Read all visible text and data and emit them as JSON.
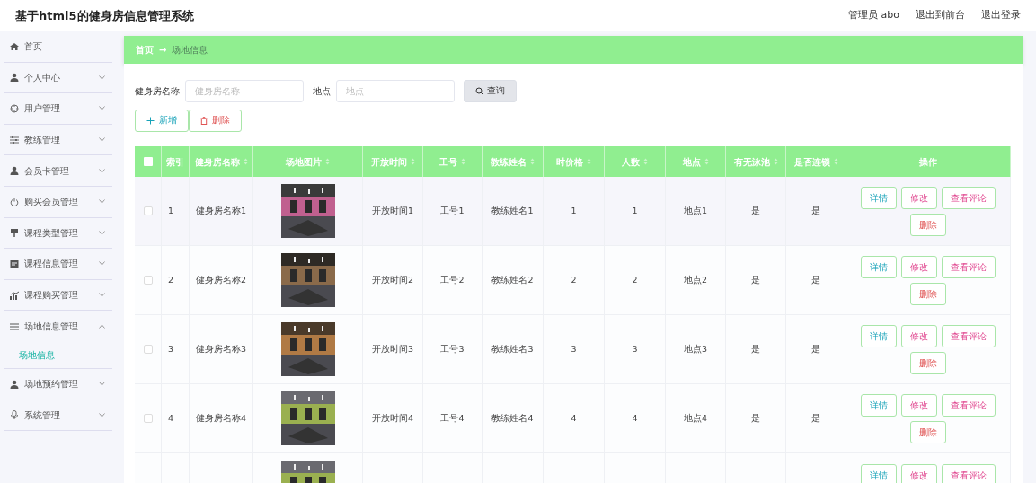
{
  "header": {
    "title": "基于html5的健身房信息管理系统",
    "links": [
      "管理员 abo",
      "退出到前台",
      "退出登录"
    ]
  },
  "sidebar": {
    "items": [
      {
        "label": "首页"
      },
      {
        "label": "个人中心",
        "expanded": false
      },
      {
        "label": "用户管理",
        "expanded": false
      },
      {
        "label": "教练管理",
        "expanded": false
      },
      {
        "label": "会员卡管理",
        "expanded": false
      },
      {
        "label": "购买会员管理",
        "expanded": false
      },
      {
        "label": "课程类型管理",
        "expanded": false
      },
      {
        "label": "课程信息管理",
        "expanded": false
      },
      {
        "label": "课程购买管理",
        "expanded": false
      },
      {
        "label": "场地信息管理",
        "expanded": true,
        "children": [
          {
            "label": "场地信息",
            "selected": true
          }
        ]
      },
      {
        "label": "场地预约管理",
        "expanded": false
      },
      {
        "label": "系统管理",
        "expanded": false
      }
    ]
  },
  "breadcrumb": [
    "首页",
    "→",
    "场地信息"
  ],
  "search": {
    "fields": [
      {
        "label": "健身房名称",
        "placeholder": "健身房名称"
      },
      {
        "label": "地点",
        "placeholder": "地点"
      }
    ],
    "button": "查询"
  },
  "toolbar": [
    {
      "label": "新增",
      "kind": "add"
    },
    {
      "label": "删除",
      "kind": "delete"
    }
  ],
  "table": {
    "select_all_checked": false,
    "columns": [
      {
        "label": "索引",
        "sortable": false
      },
      {
        "label": "健身房名称",
        "sortable": true
      },
      {
        "label": "场地图片",
        "sortable": true
      },
      {
        "label": "开放时间",
        "sortable": true
      },
      {
        "label": "工号",
        "sortable": true
      },
      {
        "label": "教练姓名",
        "sortable": true
      },
      {
        "label": "时价格",
        "sortable": true
      },
      {
        "label": "人数",
        "sortable": true
      },
      {
        "label": "地点",
        "sortable": true
      },
      {
        "label": "有无泳池",
        "sortable": true
      },
      {
        "label": "是否连锁",
        "sortable": true
      },
      {
        "label": "操作",
        "sortable": false
      }
    ],
    "rows": [
      {
        "checked": false,
        "cells": [
          "1",
          "健身房名称1",
          null,
          "开放时间1",
          "工号1",
          "教练姓名1",
          "1",
          "1",
          "地点1",
          "是",
          "是"
        ],
        "actions": [
          {
            "label": "详情",
            "kind": "detail"
          },
          {
            "label": "修改",
            "kind": "edit"
          },
          {
            "label": "查看评论",
            "kind": "comments"
          },
          {
            "label": "删除",
            "kind": "delete"
          }
        ]
      },
      {
        "checked": false,
        "cells": [
          "2",
          "健身房名称2",
          null,
          "开放时间2",
          "工号2",
          "教练姓名2",
          "2",
          "2",
          "地点2",
          "是",
          "是"
        ],
        "actions": [
          {
            "label": "详情",
            "kind": "detail"
          },
          {
            "label": "修改",
            "kind": "edit"
          },
          {
            "label": "查看评论",
            "kind": "comments"
          },
          {
            "label": "删除",
            "kind": "delete"
          }
        ]
      },
      {
        "checked": false,
        "cells": [
          "3",
          "健身房名称3",
          null,
          "开放时间3",
          "工号3",
          "教练姓名3",
          "3",
          "3",
          "地点3",
          "是",
          "是"
        ],
        "actions": [
          {
            "label": "详情",
            "kind": "detail"
          },
          {
            "label": "修改",
            "kind": "edit"
          },
          {
            "label": "查看评论",
            "kind": "comments"
          },
          {
            "label": "删除",
            "kind": "delete"
          }
        ]
      },
      {
        "checked": false,
        "cells": [
          "4",
          "健身房名称4",
          null,
          "开放时间4",
          "工号4",
          "教练姓名4",
          "4",
          "4",
          "地点4",
          "是",
          "是"
        ],
        "actions": [
          {
            "label": "详情",
            "kind": "detail"
          },
          {
            "label": "修改",
            "kind": "edit"
          },
          {
            "label": "查看评论",
            "kind": "comments"
          },
          {
            "label": "删除",
            "kind": "delete"
          }
        ]
      },
      {
        "cells": [
          null,
          null,
          null,
          null,
          null,
          null,
          null,
          null,
          null,
          null,
          null
        ],
        "actions": [
          {
            "label": "详情",
            "kind": "detail"
          },
          {
            "label": "修改",
            "kind": "edit"
          },
          {
            "label": "查看评论",
            "kind": "comments"
          }
        ]
      }
    ]
  }
}
